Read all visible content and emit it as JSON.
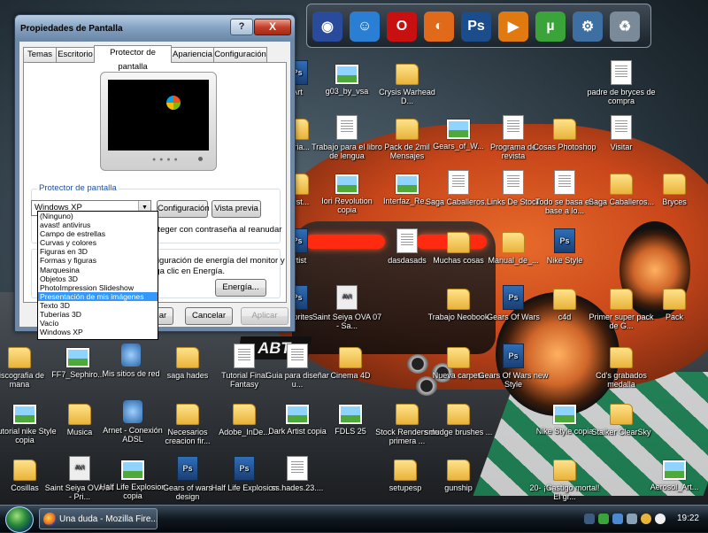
{
  "dialog": {
    "title": "Propiedades de Pantalla",
    "help_label": "?",
    "close_label": "X",
    "tabs": [
      {
        "label": "Temas"
      },
      {
        "label": "Escritorio"
      },
      {
        "label": "Protector de pantalla"
      },
      {
        "label": "Apariencia"
      },
      {
        "label": "Configuración"
      }
    ],
    "screensaver_group_label": "Protector de pantalla",
    "screensaver_selected": "Windows XP",
    "configure_button": "Configuración",
    "preview_button": "Vista previa",
    "password_text": "roteger con contraseña al reanudar",
    "energy_text_1": "nfiguración de energía del monitor y",
    "energy_text_2": "aga clic en Energía.",
    "energy_button": "Energía...",
    "ok_button": "ar",
    "cancel_button": "Cancelar",
    "apply_button": "Aplicar",
    "dropdown_items": [
      {
        "label": "(Ninguno)"
      },
      {
        "label": "avast! antivirus"
      },
      {
        "label": "Campo de estrellas"
      },
      {
        "label": "Curvas y colores"
      },
      {
        "label": "Figuras en 3D"
      },
      {
        "label": "Formas y figuras"
      },
      {
        "label": "Marquesina"
      },
      {
        "label": "Objetos 3D"
      },
      {
        "label": "PhotoImpression Slideshow"
      },
      {
        "label": "Presentación de mis imágenes"
      },
      {
        "label": "Texto 3D"
      },
      {
        "label": "Tuberías 3D"
      },
      {
        "label": "Vacío"
      },
      {
        "label": "Windows XP"
      }
    ],
    "dropdown_highlighted_index": 9
  },
  "desktop": {
    "icons": [
      {
        "label": "g03_by_vsa",
        "type": "img"
      },
      {
        "label": "Crysis Warhead D...",
        "type": "folder"
      },
      {
        "label": "padre de bryces de compra",
        "type": "doc"
      },
      {
        "label": "Trabajo para el libro de lengua",
        "type": "doc"
      },
      {
        "label": "Pack de 2mil Mensajes",
        "type": "folder"
      },
      {
        "label": "Gears_of_W...",
        "type": "img"
      },
      {
        "label": "Programa de revista",
        "type": "doc"
      },
      {
        "label": "Cosas Photoshop",
        "type": "folder"
      },
      {
        "label": "Visitar",
        "type": "doc"
      },
      {
        "label": "Iori Revolution copia",
        "type": "img"
      },
      {
        "label": "Interfaz_Re...",
        "type": "img"
      },
      {
        "label": "Saga Caballeros...",
        "type": "doc"
      },
      {
        "label": "Links De Stock",
        "type": "doc"
      },
      {
        "label": "Todo se basa en base a lo...",
        "type": "doc"
      },
      {
        "label": "Saga Caballeros...",
        "type": "folder"
      },
      {
        "label": "Bryces",
        "type": "folder"
      },
      {
        "label": "dasdasads",
        "type": "doc"
      },
      {
        "label": "Muchas cosas",
        "type": "folder"
      },
      {
        "label": "Manual_de_...",
        "type": "folder"
      },
      {
        "label": "Nike Style",
        "type": "psd"
      },
      {
        "label": "Saint Seiya OVA 07 - Sa...",
        "type": "avi"
      },
      {
        "label": "Trabajo Neobook",
        "type": "folder"
      },
      {
        "label": "Gears Of Wars",
        "type": "psd"
      },
      {
        "label": "c4d",
        "type": "folder"
      },
      {
        "label": "Primer super pack de G...",
        "type": "folder"
      },
      {
        "label": "Pack",
        "type": "folder"
      },
      {
        "label": "discografia de mana",
        "type": "folder"
      },
      {
        "label": "FF7_Sephiro...",
        "type": "img"
      },
      {
        "label": "Mis sitios de red",
        "type": "net"
      },
      {
        "label": "saga hades",
        "type": "folder"
      },
      {
        "label": "Tutorial Final Fantasy",
        "type": "doc"
      },
      {
        "label": "Guia para diseñar u...",
        "type": "doc"
      },
      {
        "label": "Cinema 4D",
        "type": "folder"
      },
      {
        "label": "Nueva carpeta",
        "type": "folder"
      },
      {
        "label": "Gears Of Wars new Style",
        "type": "psd"
      },
      {
        "label": "Cd's grabados medalla",
        "type": "folder"
      },
      {
        "label": "Tutorial nike Style copia",
        "type": "img"
      },
      {
        "label": "Musica",
        "type": "folder"
      },
      {
        "label": "Arnet - Conexión ADSL",
        "type": "net"
      },
      {
        "label": "Necesarios creacion fir...",
        "type": "folder"
      },
      {
        "label": "Adobe_InDe...",
        "type": "folder"
      },
      {
        "label": "Dark Artist copia",
        "type": "img"
      },
      {
        "label": "FDLS 25",
        "type": "img"
      },
      {
        "label": "Stock Renders de primera ...",
        "type": "folder"
      },
      {
        "label": "smudge brushes ...",
        "type": "folder"
      },
      {
        "label": "Nike Style copia",
        "type": "img"
      },
      {
        "label": "Stalker ClearSky",
        "type": "folder"
      },
      {
        "label": "Cosillas",
        "type": "folder"
      },
      {
        "label": "Saint Seiya OVA 14 - Pri...",
        "type": "avi"
      },
      {
        "label": "Half Life Explosion copia",
        "type": "img"
      },
      {
        "label": "Gears of wars design",
        "type": "psd"
      },
      {
        "label": "Half Life Explosion",
        "type": "psd"
      },
      {
        "label": "ss.hades.23....",
        "type": "doc"
      },
      {
        "label": "setupesp",
        "type": "folder"
      },
      {
        "label": "gunship",
        "type": "folder"
      },
      {
        "label": "20- ¡Castigo mortal! El gr...",
        "type": "folder"
      },
      {
        "label": "Aerosol_Art...",
        "type": "img"
      },
      {
        "label": "Varia...",
        "type": "folder"
      },
      {
        "label": "djust...",
        "type": "folder"
      },
      {
        "label": "Artist",
        "type": "psd"
      },
      {
        "label": "s Sprites",
        "type": "psd"
      },
      {
        "label": "Art",
        "type": "psd"
      }
    ],
    "car_plate": "ABT"
  },
  "dock": {
    "icons": [
      {
        "name": "orb-icon",
        "color": "#2a4b9b",
        "glyph": "◉"
      },
      {
        "name": "messenger-icon",
        "color": "#2a7fd4",
        "glyph": "☺"
      },
      {
        "name": "opera-icon",
        "color": "#c81010",
        "glyph": "O"
      },
      {
        "name": "firefox-icon",
        "color": "#e06a1a",
        "glyph": "◐"
      },
      {
        "name": "photoshop-icon",
        "color": "#1b4c8c",
        "glyph": "Ps"
      },
      {
        "name": "media-player-icon",
        "color": "#e07a10",
        "glyph": "▶"
      },
      {
        "name": "utorrent-icon",
        "color": "#3aa33a",
        "glyph": "µ"
      },
      {
        "name": "gear-icon",
        "color": "#3d6fa3",
        "glyph": "⚙"
      },
      {
        "name": "recycle-bin-icon",
        "color": "#7a8a99",
        "glyph": "♻"
      }
    ]
  },
  "taskbar": {
    "task_label": "Una duda - Mozilla Fire...",
    "clock": "19:22"
  }
}
